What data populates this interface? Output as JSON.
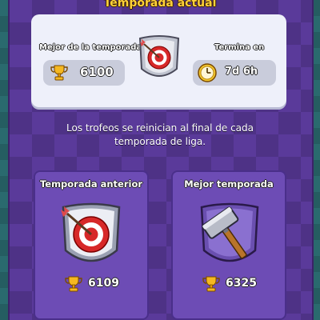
{
  "header": {
    "title": "Temporada actual"
  },
  "current_season": {
    "best_label": "Mejor de la temporada",
    "best_trophies": "6100",
    "ends_label": "Termina en",
    "ends_value": "7d 6h",
    "badge_icon": "target-arrow-shield-icon"
  },
  "info_text_line1": "Los trofeos se reinician al final de cada",
  "info_text_line2": "temporada de liga.",
  "previous_season": {
    "label": "Temporada anterior",
    "trophies": "6109",
    "badge_icon": "target-arrow-shield-icon"
  },
  "best_season": {
    "label": "Mejor temporada",
    "trophies": "6325",
    "badge_icon": "hammer-shield-icon"
  },
  "colors": {
    "title": "#ffd23a",
    "panel": "#5a3a9a",
    "card": "#eef0fa",
    "trophy": "#f5b820"
  }
}
